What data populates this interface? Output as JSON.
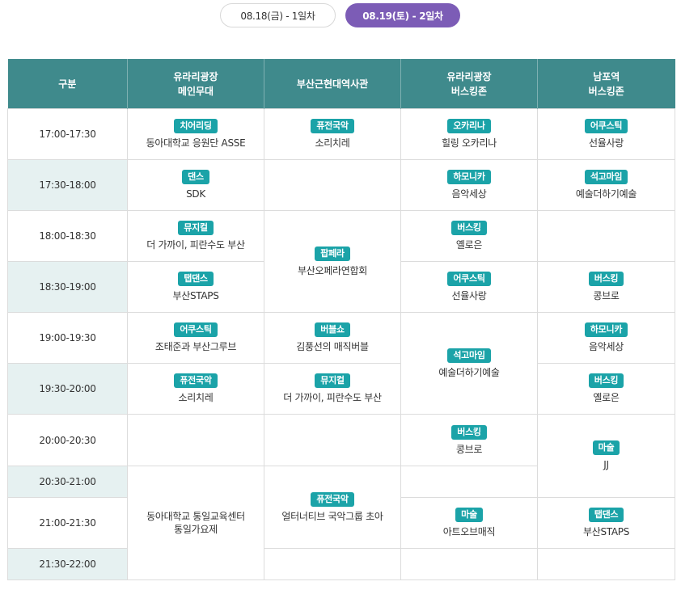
{
  "tabs": [
    {
      "label": "08.18(금) - 1일차",
      "active": false
    },
    {
      "label": "08.19(토) - 2일차",
      "active": true
    }
  ],
  "colors": {
    "header_bg": "#3f8a8c",
    "badge_bg": "#1ba3a8",
    "active_tab": "#7c5cb6",
    "alt_row": "#e6f1f1"
  },
  "header": {
    "col0": "구분",
    "col1_line1": "유라리광장",
    "col1_line2": "메인무대",
    "col2": "부산근현대역사관",
    "col3_line1": "유라리광장",
    "col3_line2": "버스킹존",
    "col4_line1": "남포역",
    "col4_line2": "버스킹존"
  },
  "times": [
    "17:00-17:30",
    "17:30-18:00",
    "18:00-18:30",
    "18:30-19:00",
    "19:00-19:30",
    "19:30-20:00",
    "20:00-20:30",
    "20:30-21:00",
    "21:00-21:30",
    "21:30-22:00"
  ],
  "cells": {
    "r0c1": {
      "tag": "치어리딩",
      "name": "동아대학교 응원단 ASSE"
    },
    "r0c2": {
      "tag": "퓨전국악",
      "name": "소리치레"
    },
    "r0c3": {
      "tag": "오카리나",
      "name": "힐링 오카리나"
    },
    "r0c4": {
      "tag": "어쿠스틱",
      "name": "선율사랑"
    },
    "r1c1": {
      "tag": "댄스",
      "name": "SDK"
    },
    "r1c3": {
      "tag": "하모니카",
      "name": "음악세상"
    },
    "r1c4": {
      "tag": "석고마임",
      "name": "예술더하기예술"
    },
    "r2c1": {
      "tag": "뮤지컬",
      "name": "더 가까이, 피란수도 부산"
    },
    "r2c2": {
      "tag": "팝페라",
      "name": "부산오페라연합회"
    },
    "r2c3": {
      "tag": "버스킹",
      "name": "옐로은"
    },
    "r3c1": {
      "tag": "탭댄스",
      "name": "부산STAPS"
    },
    "r3c3": {
      "tag": "어쿠스틱",
      "name": "선율사랑"
    },
    "r3c4": {
      "tag": "버스킹",
      "name": "콩브로"
    },
    "r4c1": {
      "tag": "어쿠스틱",
      "name": "조태준과 부산그루브"
    },
    "r4c2": {
      "tag": "버블쇼",
      "name": "김풍선의 매직버블"
    },
    "r4c3": {
      "tag": "석고마임",
      "name": "예술더하기예술"
    },
    "r4c4": {
      "tag": "하모니카",
      "name": "음악세상"
    },
    "r5c1": {
      "tag": "퓨전국악",
      "name": "소리치레"
    },
    "r5c2": {
      "tag": "뮤지컬",
      "name": "더 가까이, 피란수도 부산"
    },
    "r5c4": {
      "tag": "버스킹",
      "name": "옐로은"
    },
    "r6c3": {
      "tag": "버스킹",
      "name": "콩브로"
    },
    "r6c4": {
      "tag": "마술",
      "name": "JJ"
    },
    "r7c1": {
      "line1": "동아대학교 통일교육센터",
      "line2": "통일가요제"
    },
    "r7c2": {
      "tag": "퓨전국악",
      "name": "얼터너티브 국악그룹 초아"
    },
    "r8c3": {
      "tag": "마술",
      "name": "아트오브매직"
    },
    "r8c4": {
      "tag": "탭댄스",
      "name": "부산STAPS"
    }
  }
}
